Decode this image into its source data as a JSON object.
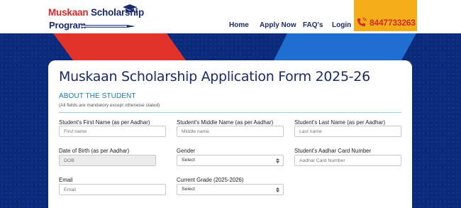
{
  "header": {
    "logo": {
      "line1_red": "Muskaan",
      "line1_navy": "Scholarship",
      "line2": "Program"
    },
    "nav": {
      "home": "Home",
      "apply": "Apply Now",
      "faq": "FAQ's",
      "login": "Login"
    },
    "phone": "8447733263"
  },
  "colors": {
    "navy": "#1a2a6c",
    "red": "#d42a2a",
    "orange": "#f4ae1a",
    "banner": "#0b2a7a",
    "accent": "#1a79b5"
  },
  "form": {
    "title": "Muskaan Scholarship Application Form 2025-26",
    "section_title": "ABOUT THE STUDENT",
    "section_note": "(All fields are mandatory except otherwise stated)",
    "first_name": {
      "label": "Student's First Name (as per Aadhar)",
      "placeholder": "First name"
    },
    "middle_name": {
      "label": "Student's Middle Name (as per Aadhar)",
      "placeholder": "Middle name"
    },
    "last_name": {
      "label": "Student's Last Name (as per Aadhar)",
      "placeholder": "Last name"
    },
    "dob": {
      "label": "Date of Birth (as per Aadhar)",
      "placeholder": "DOB"
    },
    "gender": {
      "label": "Gender",
      "value": "Select"
    },
    "aadhar": {
      "label": "Student's Aadhar Card Number",
      "placeholder": "Aadhar Card Number"
    },
    "email": {
      "label": "Email",
      "placeholder": "Email"
    },
    "grade": {
      "label": "Current Grade (2025-2026)",
      "value": "Select"
    }
  }
}
